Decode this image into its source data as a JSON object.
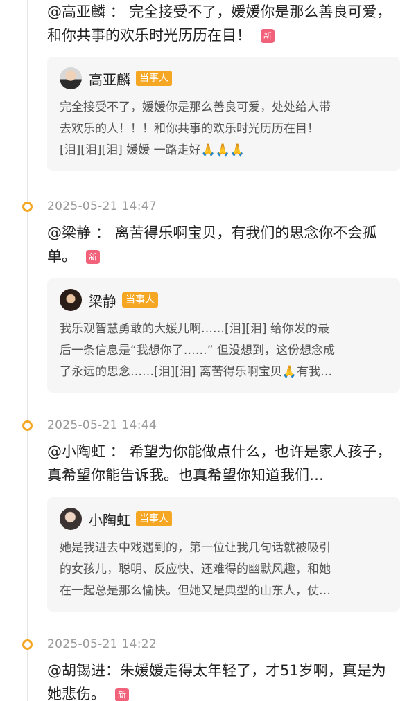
{
  "entries": [
    {
      "timestamp": "",
      "headline": "@高亚麟 ： 完全接受不了，媛媛你是那么善良可爱，和你共事的欢乐时光历历在目！",
      "badge": "新",
      "card": {
        "name": "高亚麟",
        "tag": "当事人",
        "text_lines": [
          "完全接受不了，媛媛你是那么善良可爱，处处给人带",
          "去欢乐的人！！！和你共事的欢乐时光历历在目！",
          "[泪][泪][泪] 媛媛 一路走好🙏🙏🙏"
        ]
      }
    },
    {
      "timestamp": "2025-05-21 14:47",
      "headline": "@梁静 ： 离苦得乐啊宝贝，有我们的思念你不会孤单。",
      "badge": "新",
      "card": {
        "name": "梁静",
        "tag": "当事人",
        "text_lines": [
          "我乐观智慧勇敢的大媛儿啊……[泪][泪] 给你发的最",
          "后一条信息是“我想你了……” 但没想到，这份想念成",
          "了永远的思念……[泪][泪] 离苦得乐啊宝贝🙏有我…"
        ]
      }
    },
    {
      "timestamp": "2025-05-21 14:44",
      "headline": "@小陶虹 ： 希望为你能做点什么，也许是家人孩子，真希望你能告诉我。也真希望你知道我们…",
      "badge": "",
      "card": {
        "name": "小陶虹",
        "tag": "当事人",
        "text_lines": [
          "她是我进去中戏遇到的，第一位让我几句话就被吸引",
          "的女孩儿，聪明、反应快、还难得的幽默风趣，和她",
          "在一起总是那么愉快。但她又是典型的山东人，仗…"
        ]
      }
    },
    {
      "timestamp": "2025-05-21 14:22",
      "headline": "@胡锡进：朱媛媛走得太年轻了，才51岁啊，真是为她悲伤。",
      "badge": "新",
      "card": null
    }
  ]
}
